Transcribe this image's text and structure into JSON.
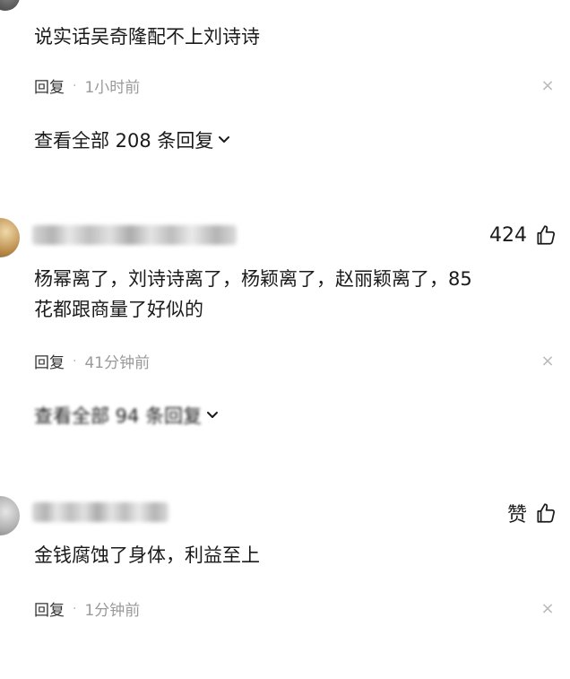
{
  "comments": [
    {
      "text": "说实话吴奇隆配不上刘诗诗",
      "reply_label": "回复",
      "separator": "·",
      "time": "1小时前",
      "view_all_label": "查看全部 208 条回复"
    },
    {
      "likes": "424",
      "text": "杨幂离了，刘诗诗离了，杨颖离了，赵丽颖离了，85\n花都跟商量了好似的",
      "reply_label": "回复",
      "separator": "·",
      "time": "41分钟前",
      "view_all_label": "查看全部 94 条回复"
    },
    {
      "likes": "赞",
      "text": "金钱腐蚀了身体，利益至上",
      "reply_label": "回复",
      "separator": "·",
      "time": "1分钟前"
    }
  ],
  "icons": {
    "close": "close-icon",
    "like": "thumbs-up-icon",
    "chevron": "chevron-down-icon"
  },
  "colors": {
    "text": "#1a1a1a",
    "meta": "#9a9a9a",
    "close": "#b8b8b8"
  }
}
